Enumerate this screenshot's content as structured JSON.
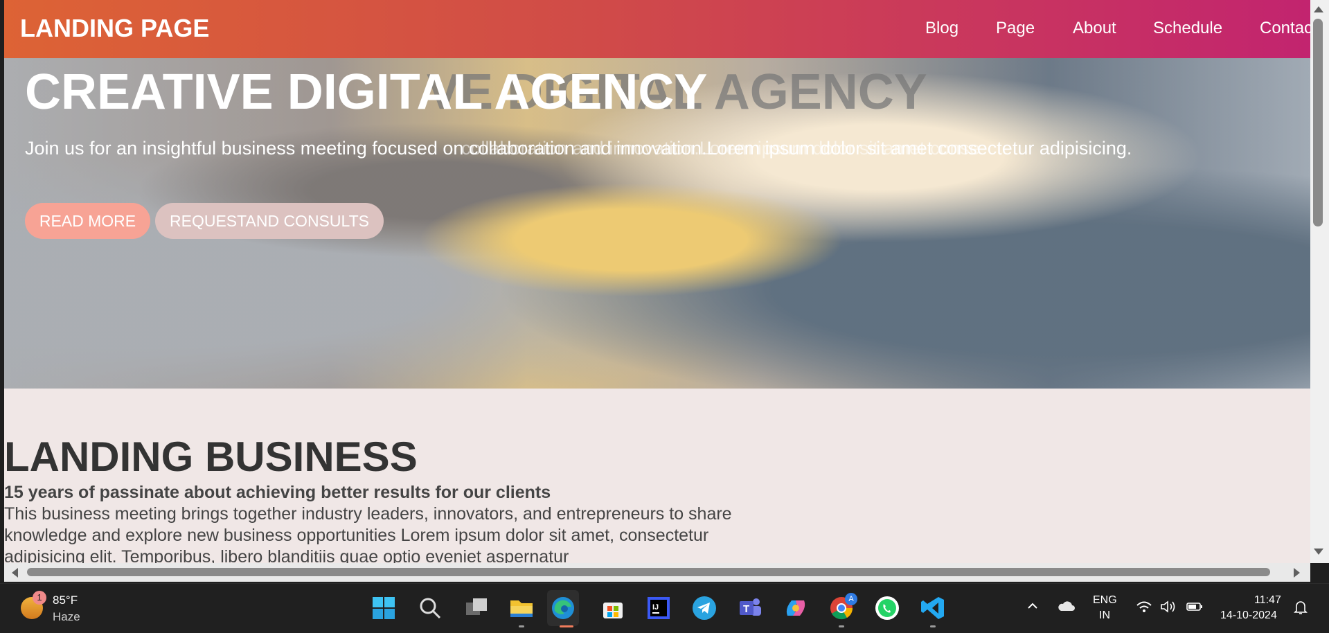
{
  "navbar": {
    "title": "LANDING PAGE",
    "links": [
      "Blog",
      "Page",
      "About",
      "Schedule",
      "Contac"
    ]
  },
  "hero": {
    "title": "CREATIVE DIGITAL AGENCY",
    "ghost_title": "VE DIGITAL AGENCY",
    "text": "Join us for an insightful business meeting focused on collaboration and innovation.Lorem ipsum dolor sit amet consectetur adipisicing.",
    "ghost_text": "collaboration and innovation.Lorem ipsum dolor sit amet conse",
    "read_more": "READ MORE",
    "consult": "REQUESTAND CONSULTS"
  },
  "business": {
    "title": "LANDING BUSINESS",
    "subtitle": "15 years of passinate about achieving better results for our clients",
    "text": "This business meeting brings together industry leaders, innovators, and entrepreneurs to share knowledge and explore new business opportunities Lorem ipsum dolor sit amet, consectetur adipisicing elit. Temporibus, libero blanditiis quae optio eveniet aspernatur"
  },
  "taskbar": {
    "weather_temp": "85°F",
    "weather_desc": "Haze",
    "weather_badge": "1",
    "language_top": "ENG",
    "language_bottom": "IN",
    "time": "11:47",
    "date": "14-10-2024",
    "apps": [
      "start-icon",
      "search-icon",
      "task-view-icon",
      "file-explorer-icon",
      "edge-icon",
      "store-icon",
      "intellij-icon",
      "telegram-icon",
      "teams-icon",
      "copilot-icon",
      "chrome-icon",
      "whatsapp-icon",
      "vscode-icon"
    ],
    "intellij_label": "IJ",
    "chrome_badge": "A"
  }
}
